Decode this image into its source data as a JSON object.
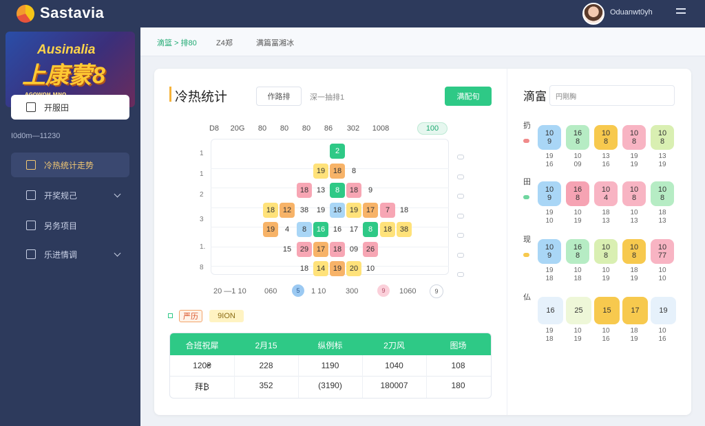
{
  "app": {
    "brand": "Sastavia",
    "user_name": "Oduanwt0yh"
  },
  "sidebar": {
    "banner": {
      "title": "Ausinalia",
      "big": "上康蒙8",
      "sub": "ᴀɢᴏᴡᴏʜ ᴍɴᴏ"
    },
    "items": [
      {
        "label": "开服田"
      },
      {
        "label": "I0d0m—11230"
      },
      {
        "label": "冷热统计走势"
      },
      {
        "label": "开奖规己"
      },
      {
        "label": "另务项目"
      },
      {
        "label": "乐进情调"
      }
    ]
  },
  "breadcrumb": [
    "滴篮 > 排80",
    "Z4郑",
    "满篇冨湘冰"
  ],
  "main": {
    "title": "冷热统计",
    "filter_btn": "作路排",
    "note": "深一抽排1",
    "action_btn": "满配旬",
    "col_headers": [
      "D8",
      "20G",
      "80",
      "80",
      "80",
      "86",
      "302",
      "1008"
    ],
    "col_pill": "100",
    "row_labels": [
      "1",
      "1",
      "2",
      "3",
      "1.",
      "8"
    ],
    "footer": {
      "left": "20 —1 10",
      "mid1": "060",
      "dot1": "5",
      "mid2": "1 10",
      "mid3": "300",
      "dot2": "9",
      "right": "1060",
      "ctrl": "9"
    },
    "legend": {
      "badge1": "严历",
      "badge2": "9ION"
    }
  },
  "chart_data": {
    "type": "heatmap",
    "x": [
      "D8",
      "20G",
      "80",
      "80",
      "80",
      "86",
      "302",
      "1008"
    ],
    "y": [
      "1",
      "1",
      "2",
      "3",
      "1.",
      "8"
    ],
    "rows": [
      [
        {
          "c": 5,
          "v": "2",
          "k": "green"
        }
      ],
      [
        {
          "c": 4,
          "v": "19",
          "k": "yellow"
        },
        {
          "c": 5,
          "v": "18",
          "k": "orange"
        },
        {
          "c": 6,
          "v": "8",
          "k": "none"
        }
      ],
      [
        {
          "c": 3,
          "v": "18",
          "k": "pink"
        },
        {
          "c": 4,
          "v": "13",
          "k": "none"
        },
        {
          "c": 5,
          "v": "8",
          "k": "green"
        },
        {
          "c": 6,
          "v": "18",
          "k": "pink"
        },
        {
          "c": 7,
          "v": "9",
          "k": "none"
        }
      ],
      [
        {
          "c": 1,
          "v": "18",
          "k": "yellow"
        },
        {
          "c": 2,
          "v": "12",
          "k": "orange"
        },
        {
          "c": 3,
          "v": "38",
          "k": "none"
        },
        {
          "c": 4,
          "v": "19",
          "k": "none"
        },
        {
          "c": 5,
          "v": "18",
          "k": "blue"
        },
        {
          "c": 6,
          "v": "19",
          "k": "yellow"
        },
        {
          "c": 7,
          "v": "17",
          "k": "orange"
        },
        {
          "c": 8,
          "v": "7",
          "k": "pink"
        },
        {
          "c": 9,
          "v": "18",
          "k": "none"
        }
      ],
      [
        {
          "c": 1,
          "v": "19",
          "k": "orange"
        },
        {
          "c": 2,
          "v": "4",
          "k": "none"
        },
        {
          "c": 3,
          "v": "8",
          "k": "blue"
        },
        {
          "c": 4,
          "v": "16",
          "k": "green"
        },
        {
          "c": 5,
          "v": "16",
          "k": "none"
        },
        {
          "c": 6,
          "v": "17",
          "k": "none"
        },
        {
          "c": 7,
          "v": "8",
          "k": "green"
        },
        {
          "c": 8,
          "v": "18",
          "k": "yellow"
        },
        {
          "c": 9,
          "v": "38",
          "k": "yellow"
        }
      ],
      [
        {
          "c": 2,
          "v": "15",
          "k": "none"
        },
        {
          "c": 3,
          "v": "29",
          "k": "pink"
        },
        {
          "c": 4,
          "v": "17",
          "k": "orange"
        },
        {
          "c": 5,
          "v": "18",
          "k": "pink"
        },
        {
          "c": 6,
          "v": "09",
          "k": "none"
        },
        {
          "c": 7,
          "v": "26",
          "k": "pink"
        }
      ],
      [
        {
          "c": 3,
          "v": "18",
          "k": "none"
        },
        {
          "c": 4,
          "v": "14",
          "k": "yellow"
        },
        {
          "c": 5,
          "v": "19",
          "k": "orange"
        },
        {
          "c": 6,
          "v": "20",
          "k": "yellow"
        },
        {
          "c": 7,
          "v": "10",
          "k": "none"
        }
      ]
    ]
  },
  "table": {
    "headers": [
      "合班祝犀",
      "2月15",
      "纵例标",
      "2刀风",
      "图场"
    ],
    "rows": [
      [
        "120₴",
        "228",
        "1190",
        "1040",
        "108"
      ],
      [
        "拜₿",
        "352",
        "(3190)",
        "180007",
        "180"
      ]
    ]
  },
  "right_panel": {
    "title": "滴富",
    "input_value": "円剛胸",
    "groups": [
      {
        "label": "扔",
        "dot": "#f08a8a",
        "balls": [
          {
            "t": "10",
            "b": "9",
            "bg": "#a9d6f6",
            "n1": "19",
            "n2": "16"
          },
          {
            "t": "16",
            "b": "8",
            "bg": "#b6ecc4",
            "n1": "10",
            "n2": "09"
          },
          {
            "t": "10",
            "b": "8",
            "bg": "#f7c94e",
            "n1": "13",
            "n2": "16"
          },
          {
            "t": "10",
            "b": "8",
            "bg": "#f8b4c3",
            "n1": "19",
            "n2": "19"
          },
          {
            "t": "10",
            "b": "8",
            "bg": "#d9efb2",
            "n1": "13",
            "n2": "19"
          }
        ]
      },
      {
        "label": "田",
        "dot": "#6fd69f",
        "balls": [
          {
            "t": "10",
            "b": "9",
            "bg": "#a9d6f6",
            "n1": "19",
            "n2": "10"
          },
          {
            "t": "16",
            "b": "8",
            "bg": "#f6a3b3",
            "n1": "10",
            "n2": "19"
          },
          {
            "t": "10",
            "b": "4",
            "bg": "#f8b4c3",
            "n1": "18",
            "n2": "13"
          },
          {
            "t": "10",
            "b": "8",
            "bg": "#f8b4c3",
            "n1": "10",
            "n2": "13"
          },
          {
            "t": "10",
            "b": "8",
            "bg": "#b6ecc4",
            "n1": "18",
            "n2": "13"
          }
        ]
      },
      {
        "label": "现",
        "dot": "#f7c94e",
        "balls": [
          {
            "t": "10",
            "b": "9",
            "bg": "#a9d6f6",
            "n1": "19",
            "n2": "18"
          },
          {
            "t": "16",
            "b": "8",
            "bg": "#b6ecc4",
            "n1": "10",
            "n2": "18"
          },
          {
            "t": "10",
            "b": "8",
            "bg": "#d9efb2",
            "n1": "10",
            "n2": "19"
          },
          {
            "t": "10",
            "b": "8",
            "bg": "#f7c94e",
            "n1": "18",
            "n2": "19"
          },
          {
            "t": "10",
            "b": "77",
            "bg": "#f8b4c3",
            "n1": "10",
            "n2": "10"
          }
        ]
      },
      {
        "label": "仏",
        "dot": "",
        "balls": [
          {
            "t": "",
            "b": "16",
            "bg": "#e6f1fb",
            "n1": "19",
            "n2": "18"
          },
          {
            "t": "",
            "b": "25",
            "bg": "#eef7d8",
            "n1": "10",
            "n2": "19"
          },
          {
            "t": "",
            "b": "15",
            "bg": "#f7c94e",
            "n1": "10",
            "n2": "16"
          },
          {
            "t": "",
            "b": "17",
            "bg": "#f7c94e",
            "n1": "18",
            "n2": "19"
          },
          {
            "t": "",
            "b": "19",
            "bg": "#e6f1fb",
            "n1": "10",
            "n2": "16"
          }
        ]
      }
    ]
  },
  "colors": {
    "accent": "#2ec986",
    "nav_bg": "#2d3a5c",
    "green": "#2ec986",
    "yellow": "#ffe27a",
    "orange": "#f7b368",
    "pink": "#f7a6b4",
    "blue": "#a9d6f6",
    "none": "transparent"
  },
  "icons": [
    "logo-icon",
    "avatar",
    "menu-icon",
    "chevron-down-icon"
  ]
}
